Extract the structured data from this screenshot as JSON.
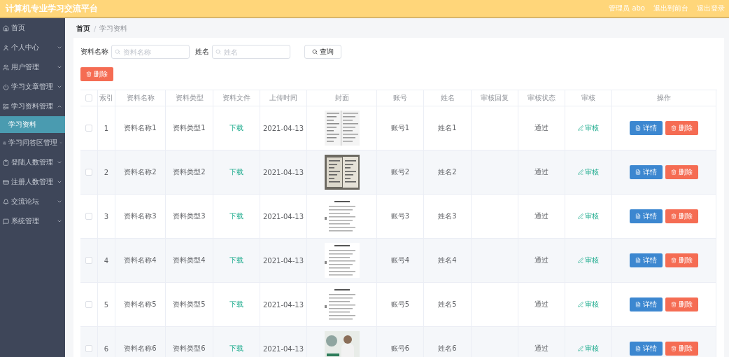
{
  "header": {
    "title": "计算机专业学习交流平台",
    "links": [
      "管理员 abo",
      "退出到前台",
      "退出登录"
    ]
  },
  "sidebar": {
    "items": [
      {
        "label": "首页"
      },
      {
        "label": "个人中心",
        "expanded": false
      },
      {
        "label": "用户管理",
        "expanded": false
      },
      {
        "label": "学习文章管理",
        "expanded": false
      },
      {
        "label": "学习资料管理",
        "expanded": true,
        "children": [
          {
            "label": "学习资料",
            "selected": true
          }
        ]
      },
      {
        "label": "学习问答区管理",
        "expanded": false
      },
      {
        "label": "登陆人数管理",
        "expanded": false
      },
      {
        "label": "注册人数管理",
        "expanded": false
      },
      {
        "label": "交流论坛",
        "expanded": false
      },
      {
        "label": "系统管理",
        "expanded": false
      }
    ]
  },
  "breadcrumb": {
    "separator": "/",
    "items": [
      "首页",
      "学习资料"
    ]
  },
  "search": {
    "fields": [
      {
        "label": "资料名称",
        "placeholder": "资料名称"
      },
      {
        "label": "姓名",
        "placeholder": "姓名"
      }
    ],
    "button": "查询"
  },
  "delete_button": "删除",
  "table": {
    "select_all_checked": false,
    "columns": [
      "索引",
      "资料名称",
      "资料类型",
      "资料文件",
      "上传时间",
      "封面",
      "账号",
      "姓名",
      "审核回复",
      "审核状态",
      "审核",
      "操作"
    ],
    "rows": [
      {
        "checked": false,
        "index": "1",
        "name": "资料名称1",
        "type": "资料类型1",
        "file": "下载",
        "time": "2021-04-13",
        "cover": {
          "kind": "picture"
        },
        "account": "账号1",
        "person": "姓名1",
        "status": "通过",
        "review": "审核",
        "actions": [
          "详情",
          "删除"
        ]
      },
      {
        "checked": false,
        "index": "2",
        "name": "资料名称2",
        "type": "资料类型2",
        "file": "下载",
        "time": "2021-04-13",
        "cover": {
          "kind": "picture"
        },
        "account": "账号2",
        "person": "姓名2",
        "status": "通过",
        "review": "审核",
        "actions": [
          "详情",
          "删除"
        ]
      },
      {
        "checked": false,
        "index": "3",
        "name": "资料名称3",
        "type": "资料类型3",
        "file": "下载",
        "time": "2021-04-13",
        "cover": {
          "kind": "picture"
        },
        "account": "账号3",
        "person": "姓名3",
        "status": "通过",
        "review": "审核",
        "actions": [
          "详情",
          "删除"
        ]
      },
      {
        "checked": false,
        "index": "4",
        "name": "资料名称4",
        "type": "资料类型4",
        "file": "下载",
        "time": "2021-04-13",
        "cover": {
          "kind": "picture"
        },
        "account": "账号4",
        "person": "姓名4",
        "status": "通过",
        "review": "审核",
        "actions": [
          "详情",
          "删除"
        ]
      },
      {
        "checked": false,
        "index": "5",
        "name": "资料名称5",
        "type": "资料类型5",
        "file": "下载",
        "time": "2021-04-13",
        "cover": {
          "kind": "picture"
        },
        "account": "账号5",
        "person": "姓名5",
        "status": "通过",
        "review": "审核",
        "actions": [
          "详情",
          "删除"
        ]
      },
      {
        "checked": false,
        "index": "6",
        "name": "资料名称6",
        "type": "资料类型6",
        "file": "下载",
        "time": "2021-04-13",
        "cover": {
          "kind": "picture"
        },
        "account": "账号6",
        "person": "姓名6",
        "status": "通过",
        "review": "审核",
        "actions": [
          "详情",
          "删除"
        ]
      }
    ]
  }
}
